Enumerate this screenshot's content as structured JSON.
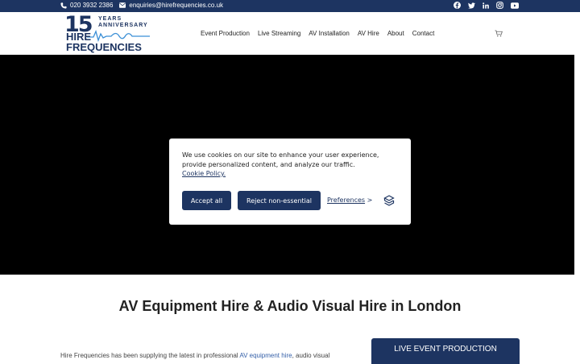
{
  "topbar": {
    "phone": "020 3932 2386",
    "email": "enquiries@hirefrequencies.co.uk",
    "social_icons": [
      "facebook-icon",
      "twitter-icon",
      "linkedin-icon",
      "instagram-icon",
      "youtube-icon"
    ]
  },
  "logo": {
    "number": "15",
    "years_line1": "YEARS",
    "years_line2": "ANNIVERSARY",
    "word1": "HIRE",
    "word2": "FREQUENCIES"
  },
  "nav": {
    "items": [
      "Event Production",
      "Live Streaming",
      "AV Installation",
      "AV Hire",
      "About",
      "Contact"
    ]
  },
  "cookie": {
    "message": "We use cookies on our site to enhance your user experience, provide personalized content, and analyze our traffic.",
    "policy_link": "Cookie Policy.",
    "accept_label": "Accept all",
    "reject_label": "Reject non-essential",
    "preferences_label": "Preferences",
    "preferences_arrow": ">"
  },
  "main": {
    "title": "AV Equipment Hire & Audio Visual Hire in London",
    "para_prefix": "Hire Frequencies has been supplying the latest in professional ",
    "para_link": "AV equipment hire",
    "para_suffix": ", audio visual",
    "live_button": "LIVE EVENT PRODUCTION"
  },
  "colors": {
    "brand": "#1d3461",
    "hero": "#000000"
  }
}
